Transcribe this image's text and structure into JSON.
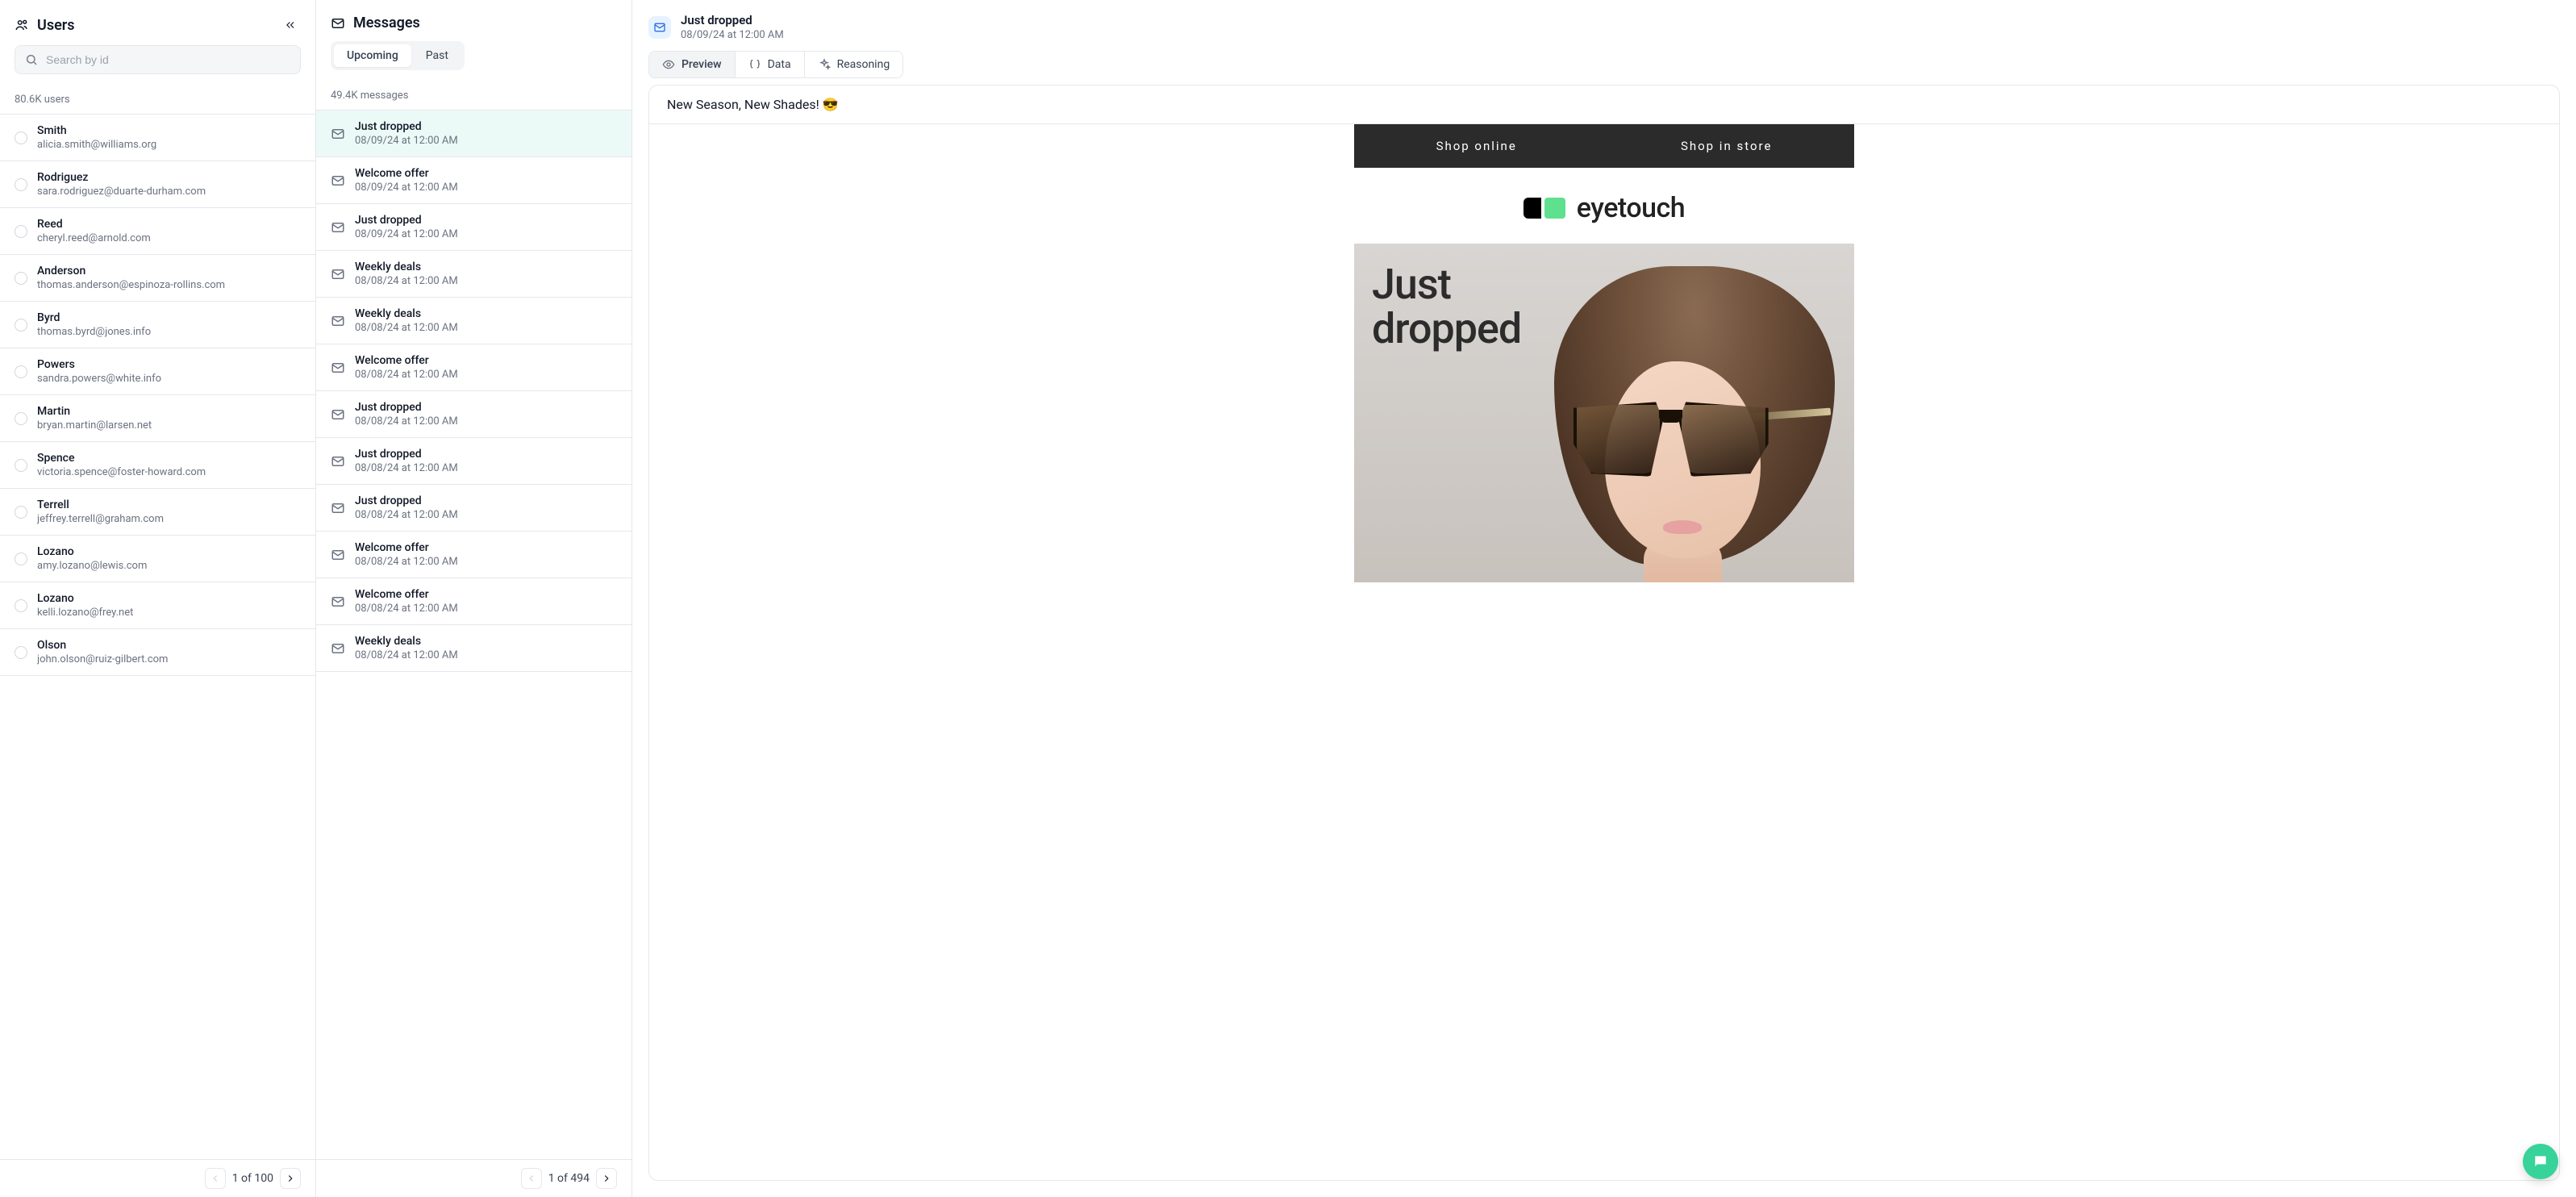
{
  "users_panel": {
    "title": "Users",
    "search_placeholder": "Search by id",
    "count_label": "80.6K users",
    "items": [
      {
        "name": "Smith",
        "email": "alicia.smith@williams.org"
      },
      {
        "name": "Rodriguez",
        "email": "sara.rodriguez@duarte-durham.com"
      },
      {
        "name": "Reed",
        "email": "cheryl.reed@arnold.com"
      },
      {
        "name": "Anderson",
        "email": "thomas.anderson@espinoza-rollins.com"
      },
      {
        "name": "Byrd",
        "email": "thomas.byrd@jones.info"
      },
      {
        "name": "Powers",
        "email": "sandra.powers@white.info"
      },
      {
        "name": "Martin",
        "email": "bryan.martin@larsen.net"
      },
      {
        "name": "Spence",
        "email": "victoria.spence@foster-howard.com"
      },
      {
        "name": "Terrell",
        "email": "jeffrey.terrell@graham.com"
      },
      {
        "name": "Lozano",
        "email": "amy.lozano@lewis.com"
      },
      {
        "name": "Lozano",
        "email": "kelli.lozano@frey.net"
      },
      {
        "name": "Olson",
        "email": "john.olson@ruiz-gilbert.com"
      }
    ],
    "pager_label": "1 of 100"
  },
  "messages_panel": {
    "title": "Messages",
    "tabs": {
      "upcoming": "Upcoming",
      "past": "Past"
    },
    "count_label": "49.4K messages",
    "items": [
      {
        "title": "Just dropped",
        "timestamp": "08/09/24 at 12:00 AM",
        "selected": true
      },
      {
        "title": "Welcome offer",
        "timestamp": "08/09/24 at 12:00 AM"
      },
      {
        "title": "Just dropped",
        "timestamp": "08/09/24 at 12:00 AM"
      },
      {
        "title": "Weekly deals",
        "timestamp": "08/08/24 at 12:00 AM"
      },
      {
        "title": "Weekly deals",
        "timestamp": "08/08/24 at 12:00 AM"
      },
      {
        "title": "Welcome offer",
        "timestamp": "08/08/24 at 12:00 AM"
      },
      {
        "title": "Just dropped",
        "timestamp": "08/08/24 at 12:00 AM"
      },
      {
        "title": "Just dropped",
        "timestamp": "08/08/24 at 12:00 AM"
      },
      {
        "title": "Just dropped",
        "timestamp": "08/08/24 at 12:00 AM"
      },
      {
        "title": "Welcome offer",
        "timestamp": "08/08/24 at 12:00 AM"
      },
      {
        "title": "Welcome offer",
        "timestamp": "08/08/24 at 12:00 AM"
      },
      {
        "title": "Weekly deals",
        "timestamp": "08/08/24 at 12:00 AM"
      }
    ],
    "pager_label": "1 of 494"
  },
  "detail": {
    "title": "Just dropped",
    "timestamp": "08/09/24 at 12:00 AM",
    "tabs": {
      "preview": "Preview",
      "data": "Data",
      "reasoning": "Reasoning"
    },
    "subject": "New Season, New Shades! 😎",
    "email": {
      "shop_online": "Shop online",
      "shop_in_store": "Shop in store",
      "brand": "eyetouch",
      "hero_line1": "Just",
      "hero_line2": "dropped"
    }
  }
}
